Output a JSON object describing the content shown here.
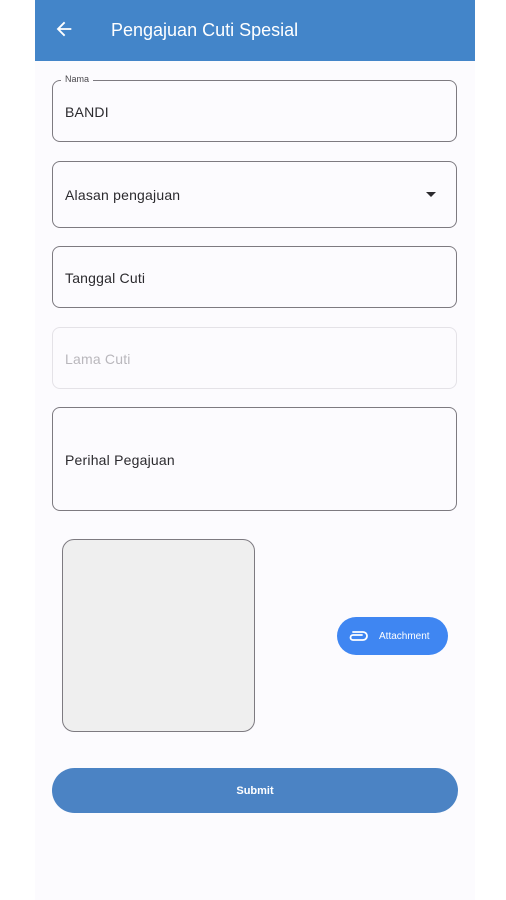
{
  "app_bar": {
    "title": "Pengajuan Cuti Spesial",
    "color": "#4385c9",
    "back_icon": "arrow-left-icon"
  },
  "form": {
    "nama": {
      "label": "Nama",
      "value": "BANDI"
    },
    "alasan": {
      "placeholder": "Alasan pengajuan",
      "icon": "dropdown-arrow-icon"
    },
    "tanggal": {
      "placeholder": "Tanggal Cuti"
    },
    "lama": {
      "placeholder": "Lama Cuti",
      "disabled": true
    },
    "perihal": {
      "placeholder": "Perihal Pegajuan"
    }
  },
  "attachment": {
    "label": "Attachment",
    "icon": "paperclip-icon",
    "color": "#3f86f2"
  },
  "submit": {
    "label": "Submit",
    "color": "#4b83c4"
  }
}
